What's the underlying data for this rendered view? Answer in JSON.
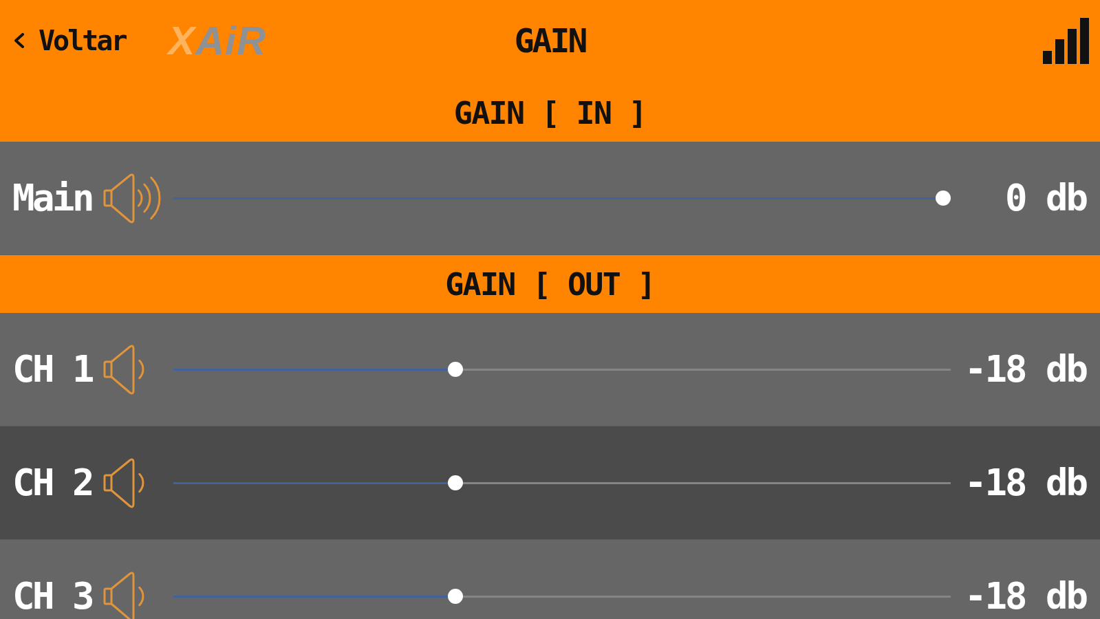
{
  "header": {
    "back_label": "Voltar",
    "logo": "XAiR",
    "title": "GAIN"
  },
  "sections": [
    {
      "title": "GAIN [ IN ]",
      "channels": [
        {
          "name": "Main",
          "kind": "main",
          "level": 1,
          "reading": "0 db"
        }
      ]
    },
    {
      "title": "GAIN [ OUT ]",
      "channels": [
        {
          "name": "CH 1",
          "kind": "channel",
          "level": 0.36,
          "reading": "-18 db"
        },
        {
          "name": "CH 2",
          "kind": "channel",
          "level": 0.36,
          "reading": "-18 db"
        },
        {
          "name": "CH 3",
          "kind": "channel",
          "level": 0.36,
          "reading": "-18 db"
        }
      ]
    }
  ]
}
